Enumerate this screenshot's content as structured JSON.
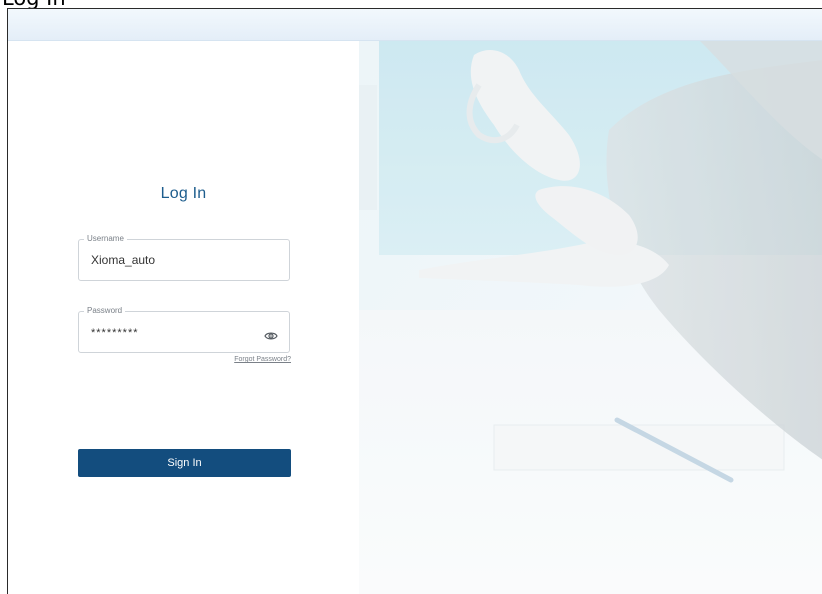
{
  "page": {
    "title": "Log In"
  },
  "login": {
    "title": "Log In",
    "username": {
      "label": "Username",
      "value": "Xioma_auto"
    },
    "password": {
      "label": "Password",
      "value": "*********",
      "toggle_icon": "eye-icon"
    },
    "forgot_password": "Forgot Password?",
    "sign_in": "Sign In"
  },
  "theme": {
    "primary": "#134d7e",
    "title_color": "#1d5d8d",
    "header_gradient_top": "#f2f8fd",
    "header_gradient_bottom": "#e4eef8"
  },
  "hero": {
    "description_icon": "hands-meeting-photo"
  }
}
